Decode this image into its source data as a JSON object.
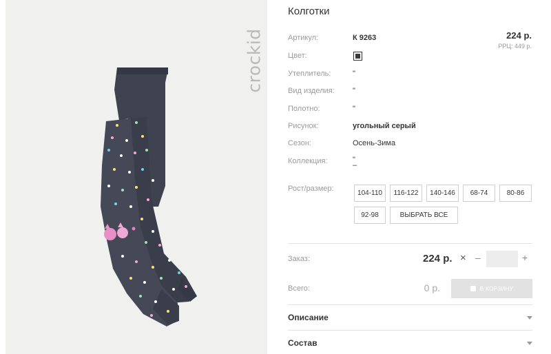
{
  "brand": {
    "logo_text": "crockid"
  },
  "product": {
    "title": "Колготки",
    "price": "224 р.",
    "rrc": "РРЦ: 449 р."
  },
  "specs": [
    {
      "label": "Артикул:",
      "value": "К 9263"
    },
    {
      "label": "Цвет:",
      "value": ""
    },
    {
      "label": "Утеплитель:",
      "value": "\""
    },
    {
      "label": "Вид изделия:",
      "value": "\""
    },
    {
      "label": "Полотно:",
      "value": "\""
    },
    {
      "label": "Рисунок:",
      "value": "угольный серый"
    },
    {
      "label": "Сезон:",
      "value": "Осень-Зима"
    },
    {
      "label": "Коллекция:",
      "value": "\"",
      "value2": "–"
    }
  ],
  "color_swatch": {
    "hex": "#3a3a3a"
  },
  "sizes": {
    "label": "Рост/размер:",
    "options": [
      "104-110",
      "116-122",
      "140-146",
      "68-74",
      "80-86",
      "92-98"
    ],
    "select_all": "ВЫБРАТЬ ВСЕ"
  },
  "order": {
    "label": "Заказ:",
    "price": "224 р.",
    "times": "×",
    "minus": "–",
    "plus": "+",
    "qty_value": ""
  },
  "total": {
    "label": "Всего:",
    "value": "0 р.",
    "cart_button": "В КОРЗИНУ"
  },
  "accordions": [
    {
      "label": "Описание",
      "icon": "chevron-down-icon"
    },
    {
      "label": "Состав",
      "icon": "chevron-down-icon"
    }
  ],
  "colors": {
    "photo_bg": "#f0f0ef",
    "sock_main": "#3f4350",
    "cart_button_bg": "#e2e2e2"
  }
}
